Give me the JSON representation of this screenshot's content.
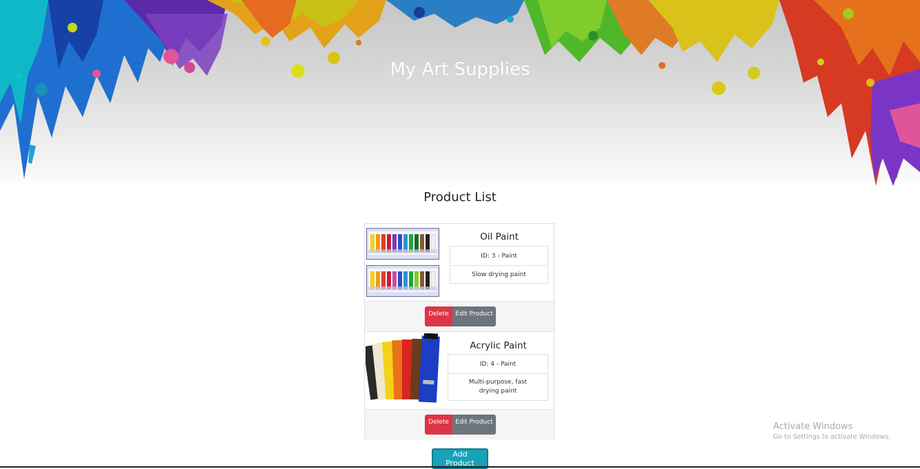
{
  "header": {
    "title": "My Art Supplies"
  },
  "product_list": {
    "title": "Product List",
    "products": [
      {
        "name": "Oil Paint",
        "id_line": "ID: 3 - Paint",
        "description": "Slow drying paint",
        "delete_label": "Delete",
        "edit_label": "Edit Product"
      },
      {
        "name": "Acrylic Paint",
        "id_line": "ID: 4 - Paint",
        "description": "Multi-purpose, fast drying paint",
        "delete_label": "Delete",
        "edit_label": "Edit Product"
      }
    ],
    "add_label": "Add Product"
  },
  "watermark": {
    "title": "Activate Windows",
    "subtitle": "Go to Settings to activate Windows."
  },
  "colors": {
    "delete": "#dc3545",
    "edit": "#6c757d",
    "add": "#17a2b8",
    "title_text": "#ffffff"
  }
}
